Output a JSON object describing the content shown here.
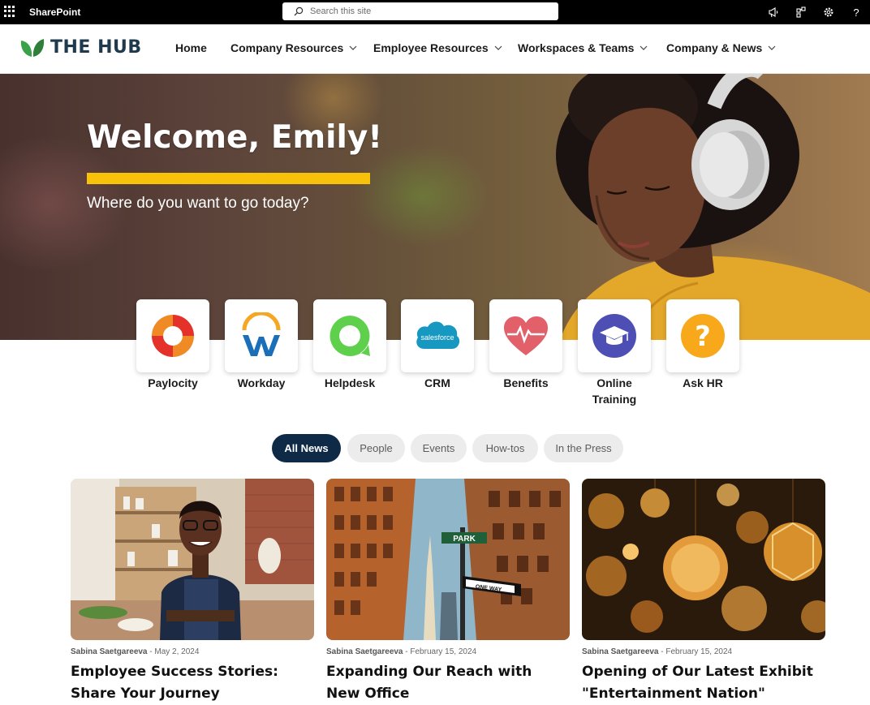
{
  "suite_bar": {
    "app_name": "SharePoint",
    "search_placeholder": "Search this site",
    "icons": [
      "waffle-icon",
      "megaphone-icon",
      "share-icon",
      "gear-icon",
      "help-icon"
    ]
  },
  "nav": {
    "logo_text": "THE HUB",
    "items": [
      {
        "label": "Home",
        "has_dropdown": false
      },
      {
        "label": "Company Resources",
        "has_dropdown": true
      },
      {
        "label": "Employee Resources",
        "has_dropdown": true
      },
      {
        "label": "Workspaces & Teams",
        "has_dropdown": true
      },
      {
        "label": "Company & News",
        "has_dropdown": true
      }
    ]
  },
  "hero": {
    "title": "Welcome, Emily!",
    "subtitle": "Where do you want to go today?",
    "accent_color": "#f8c20a"
  },
  "quick_links": [
    {
      "label": "Paylocity",
      "icon": "paylocity-icon"
    },
    {
      "label": "Workday",
      "icon": "workday-icon"
    },
    {
      "label": "Helpdesk",
      "icon": "helpdesk-icon"
    },
    {
      "label": "CRM",
      "icon": "salesforce-icon",
      "icon_text": "salesforce"
    },
    {
      "label": "Benefits",
      "icon": "heart-pulse-icon"
    },
    {
      "label": "Online Training",
      "icon": "graduation-cap-icon"
    },
    {
      "label": "Ask HR",
      "icon": "question-icon"
    }
  ],
  "news_filters": {
    "active": "All News",
    "items": [
      "All News",
      "People",
      "Events",
      "How-tos",
      "In the Press"
    ]
  },
  "news": [
    {
      "author": "Sabina Saetgareeva",
      "date": "May 2, 2024",
      "title": "Employee Success Stories: Share Your Journey"
    },
    {
      "author": "Sabina Saetgareeva",
      "date": "February 15, 2024",
      "title": "Expanding Our Reach with New Office",
      "street_signs": [
        "PARK",
        "ONE WAY"
      ]
    },
    {
      "author": "Sabina Saetgareeva",
      "date": "February 15, 2024",
      "title": "Opening of Our Latest Exhibit \"Entertainment Nation\""
    }
  ],
  "colors": {
    "suite_bar": "#000000",
    "active_pill": "#0e2a47",
    "logo_text": "#1f3a4d",
    "logo_leaf": "#3aa14a"
  }
}
